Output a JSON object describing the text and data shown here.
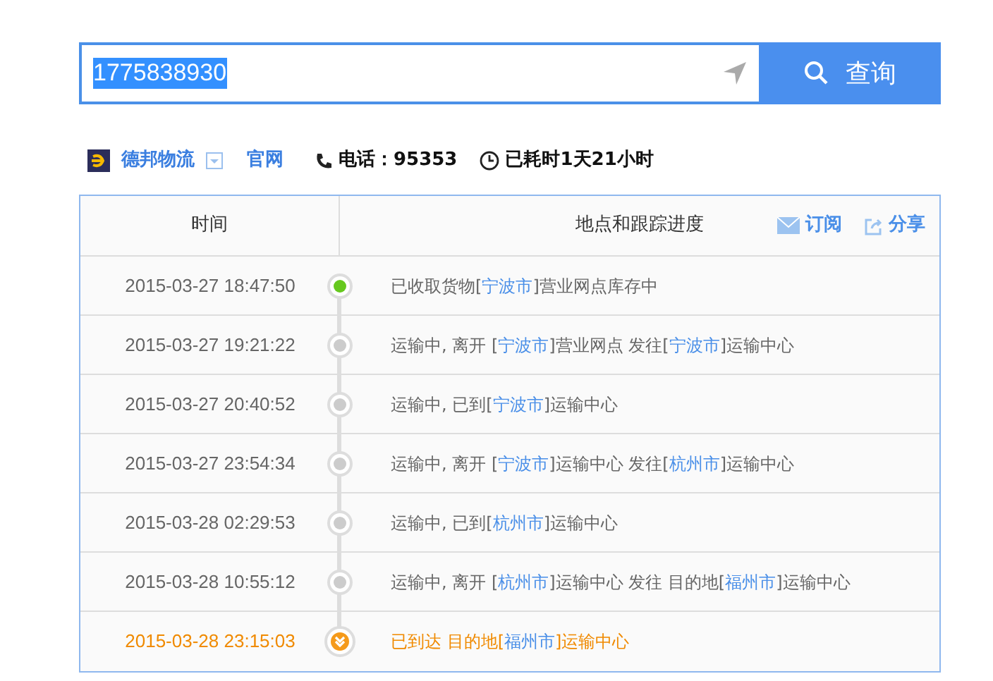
{
  "search": {
    "value": "1775838930",
    "button": "查询"
  },
  "carrier": {
    "name": "德邦物流",
    "website": "官网",
    "phone_label": "电话：",
    "phone": "95353",
    "elapsed": "已耗时1天21小时"
  },
  "table": {
    "columns": [
      "时间",
      "地点和跟踪进度"
    ],
    "actions": [
      {
        "kind": "subscribe",
        "label": "订阅"
      },
      {
        "kind": "share",
        "label": "分享"
      }
    ],
    "rows": [
      {
        "time": "2015-03-27 18:47:50",
        "kind": "collected",
        "segments": [
          {
            "kind": "plain",
            "text": "已收取货物["
          },
          {
            "kind": "place",
            "text": "宁波市"
          },
          {
            "kind": "plain",
            "text": "]营业网点库存中"
          }
        ]
      },
      {
        "time": "2015-03-27 19:21:22",
        "kind": "transit",
        "segments": [
          {
            "kind": "plain",
            "text": "运输中, 离开 ["
          },
          {
            "kind": "place",
            "text": "宁波市"
          },
          {
            "kind": "plain",
            "text": "]营业网点 发往["
          },
          {
            "kind": "place",
            "text": "宁波市"
          },
          {
            "kind": "plain",
            "text": "]运输中心"
          }
        ]
      },
      {
        "time": "2015-03-27 20:40:52",
        "kind": "transit",
        "segments": [
          {
            "kind": "plain",
            "text": "运输中, 已到["
          },
          {
            "kind": "place",
            "text": "宁波市"
          },
          {
            "kind": "plain",
            "text": "]运输中心"
          }
        ]
      },
      {
        "time": "2015-03-27 23:54:34",
        "kind": "transit",
        "segments": [
          {
            "kind": "plain",
            "text": "运输中, 离开 ["
          },
          {
            "kind": "place",
            "text": "宁波市"
          },
          {
            "kind": "plain",
            "text": "]运输中心 发往["
          },
          {
            "kind": "place",
            "text": "杭州市"
          },
          {
            "kind": "plain",
            "text": "]运输中心"
          }
        ]
      },
      {
        "time": "2015-03-28 02:29:53",
        "kind": "transit",
        "segments": [
          {
            "kind": "plain",
            "text": "运输中, 已到["
          },
          {
            "kind": "place",
            "text": "杭州市"
          },
          {
            "kind": "plain",
            "text": "]运输中心"
          }
        ]
      },
      {
        "time": "2015-03-28 10:55:12",
        "kind": "transit",
        "segments": [
          {
            "kind": "plain",
            "text": "运输中, 离开 ["
          },
          {
            "kind": "place",
            "text": "杭州市"
          },
          {
            "kind": "plain",
            "text": "]运输中心 发往 目的地["
          },
          {
            "kind": "place",
            "text": "福州市"
          },
          {
            "kind": "plain",
            "text": "]运输中心"
          }
        ]
      },
      {
        "time": "2015-03-28 23:15:03",
        "kind": "delivered",
        "segments": [
          {
            "kind": "plain",
            "text": "已到达 目的地["
          },
          {
            "kind": "place",
            "text": "福州市"
          },
          {
            "kind": "plain",
            "text": "]运输中心"
          }
        ]
      }
    ]
  }
}
